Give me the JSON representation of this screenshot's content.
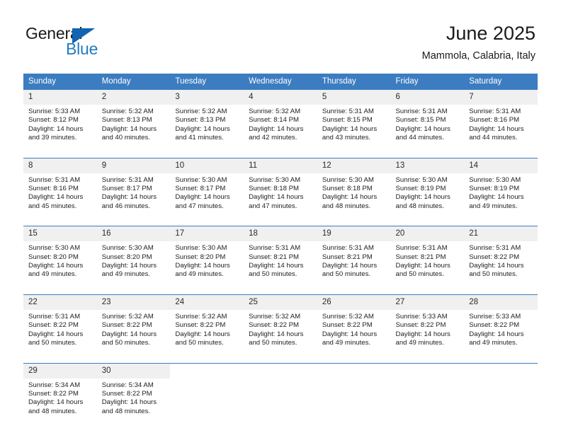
{
  "brand": {
    "name_part1": "General",
    "name_part2": "Blue",
    "accent_color": "#1e7bc4",
    "flag_color": "#1263b0"
  },
  "header": {
    "title": "June 2025",
    "subtitle": "Mammola, Calabria, Italy",
    "header_bg_color": "#3b7dc0"
  },
  "weekdays": [
    "Sunday",
    "Monday",
    "Tuesday",
    "Wednesday",
    "Thursday",
    "Friday",
    "Saturday"
  ],
  "weeks": [
    [
      {
        "day": "1",
        "sunrise": "Sunrise: 5:33 AM",
        "sunset": "Sunset: 8:12 PM",
        "daylight_line1": "Daylight: 14 hours",
        "daylight_line2": "and 39 minutes."
      },
      {
        "day": "2",
        "sunrise": "Sunrise: 5:32 AM",
        "sunset": "Sunset: 8:13 PM",
        "daylight_line1": "Daylight: 14 hours",
        "daylight_line2": "and 40 minutes."
      },
      {
        "day": "3",
        "sunrise": "Sunrise: 5:32 AM",
        "sunset": "Sunset: 8:13 PM",
        "daylight_line1": "Daylight: 14 hours",
        "daylight_line2": "and 41 minutes."
      },
      {
        "day": "4",
        "sunrise": "Sunrise: 5:32 AM",
        "sunset": "Sunset: 8:14 PM",
        "daylight_line1": "Daylight: 14 hours",
        "daylight_line2": "and 42 minutes."
      },
      {
        "day": "5",
        "sunrise": "Sunrise: 5:31 AM",
        "sunset": "Sunset: 8:15 PM",
        "daylight_line1": "Daylight: 14 hours",
        "daylight_line2": "and 43 minutes."
      },
      {
        "day": "6",
        "sunrise": "Sunrise: 5:31 AM",
        "sunset": "Sunset: 8:15 PM",
        "daylight_line1": "Daylight: 14 hours",
        "daylight_line2": "and 44 minutes."
      },
      {
        "day": "7",
        "sunrise": "Sunrise: 5:31 AM",
        "sunset": "Sunset: 8:16 PM",
        "daylight_line1": "Daylight: 14 hours",
        "daylight_line2": "and 44 minutes."
      }
    ],
    [
      {
        "day": "8",
        "sunrise": "Sunrise: 5:31 AM",
        "sunset": "Sunset: 8:16 PM",
        "daylight_line1": "Daylight: 14 hours",
        "daylight_line2": "and 45 minutes."
      },
      {
        "day": "9",
        "sunrise": "Sunrise: 5:31 AM",
        "sunset": "Sunset: 8:17 PM",
        "daylight_line1": "Daylight: 14 hours",
        "daylight_line2": "and 46 minutes."
      },
      {
        "day": "10",
        "sunrise": "Sunrise: 5:30 AM",
        "sunset": "Sunset: 8:17 PM",
        "daylight_line1": "Daylight: 14 hours",
        "daylight_line2": "and 47 minutes."
      },
      {
        "day": "11",
        "sunrise": "Sunrise: 5:30 AM",
        "sunset": "Sunset: 8:18 PM",
        "daylight_line1": "Daylight: 14 hours",
        "daylight_line2": "and 47 minutes."
      },
      {
        "day": "12",
        "sunrise": "Sunrise: 5:30 AM",
        "sunset": "Sunset: 8:18 PM",
        "daylight_line1": "Daylight: 14 hours",
        "daylight_line2": "and 48 minutes."
      },
      {
        "day": "13",
        "sunrise": "Sunrise: 5:30 AM",
        "sunset": "Sunset: 8:19 PM",
        "daylight_line1": "Daylight: 14 hours",
        "daylight_line2": "and 48 minutes."
      },
      {
        "day": "14",
        "sunrise": "Sunrise: 5:30 AM",
        "sunset": "Sunset: 8:19 PM",
        "daylight_line1": "Daylight: 14 hours",
        "daylight_line2": "and 49 minutes."
      }
    ],
    [
      {
        "day": "15",
        "sunrise": "Sunrise: 5:30 AM",
        "sunset": "Sunset: 8:20 PM",
        "daylight_line1": "Daylight: 14 hours",
        "daylight_line2": "and 49 minutes."
      },
      {
        "day": "16",
        "sunrise": "Sunrise: 5:30 AM",
        "sunset": "Sunset: 8:20 PM",
        "daylight_line1": "Daylight: 14 hours",
        "daylight_line2": "and 49 minutes."
      },
      {
        "day": "17",
        "sunrise": "Sunrise: 5:30 AM",
        "sunset": "Sunset: 8:20 PM",
        "daylight_line1": "Daylight: 14 hours",
        "daylight_line2": "and 49 minutes."
      },
      {
        "day": "18",
        "sunrise": "Sunrise: 5:31 AM",
        "sunset": "Sunset: 8:21 PM",
        "daylight_line1": "Daylight: 14 hours",
        "daylight_line2": "and 50 minutes."
      },
      {
        "day": "19",
        "sunrise": "Sunrise: 5:31 AM",
        "sunset": "Sunset: 8:21 PM",
        "daylight_line1": "Daylight: 14 hours",
        "daylight_line2": "and 50 minutes."
      },
      {
        "day": "20",
        "sunrise": "Sunrise: 5:31 AM",
        "sunset": "Sunset: 8:21 PM",
        "daylight_line1": "Daylight: 14 hours",
        "daylight_line2": "and 50 minutes."
      },
      {
        "day": "21",
        "sunrise": "Sunrise: 5:31 AM",
        "sunset": "Sunset: 8:22 PM",
        "daylight_line1": "Daylight: 14 hours",
        "daylight_line2": "and 50 minutes."
      }
    ],
    [
      {
        "day": "22",
        "sunrise": "Sunrise: 5:31 AM",
        "sunset": "Sunset: 8:22 PM",
        "daylight_line1": "Daylight: 14 hours",
        "daylight_line2": "and 50 minutes."
      },
      {
        "day": "23",
        "sunrise": "Sunrise: 5:32 AM",
        "sunset": "Sunset: 8:22 PM",
        "daylight_line1": "Daylight: 14 hours",
        "daylight_line2": "and 50 minutes."
      },
      {
        "day": "24",
        "sunrise": "Sunrise: 5:32 AM",
        "sunset": "Sunset: 8:22 PM",
        "daylight_line1": "Daylight: 14 hours",
        "daylight_line2": "and 50 minutes."
      },
      {
        "day": "25",
        "sunrise": "Sunrise: 5:32 AM",
        "sunset": "Sunset: 8:22 PM",
        "daylight_line1": "Daylight: 14 hours",
        "daylight_line2": "and 50 minutes."
      },
      {
        "day": "26",
        "sunrise": "Sunrise: 5:32 AM",
        "sunset": "Sunset: 8:22 PM",
        "daylight_line1": "Daylight: 14 hours",
        "daylight_line2": "and 49 minutes."
      },
      {
        "day": "27",
        "sunrise": "Sunrise: 5:33 AM",
        "sunset": "Sunset: 8:22 PM",
        "daylight_line1": "Daylight: 14 hours",
        "daylight_line2": "and 49 minutes."
      },
      {
        "day": "28",
        "sunrise": "Sunrise: 5:33 AM",
        "sunset": "Sunset: 8:22 PM",
        "daylight_line1": "Daylight: 14 hours",
        "daylight_line2": "and 49 minutes."
      }
    ],
    [
      {
        "day": "29",
        "sunrise": "Sunrise: 5:34 AM",
        "sunset": "Sunset: 8:22 PM",
        "daylight_line1": "Daylight: 14 hours",
        "daylight_line2": "and 48 minutes."
      },
      {
        "day": "30",
        "sunrise": "Sunrise: 5:34 AM",
        "sunset": "Sunset: 8:22 PM",
        "daylight_line1": "Daylight: 14 hours",
        "daylight_line2": "and 48 minutes."
      },
      {
        "day": "",
        "sunrise": "",
        "sunset": "",
        "daylight_line1": "",
        "daylight_line2": ""
      },
      {
        "day": "",
        "sunrise": "",
        "sunset": "",
        "daylight_line1": "",
        "daylight_line2": ""
      },
      {
        "day": "",
        "sunrise": "",
        "sunset": "",
        "daylight_line1": "",
        "daylight_line2": ""
      },
      {
        "day": "",
        "sunrise": "",
        "sunset": "",
        "daylight_line1": "",
        "daylight_line2": ""
      },
      {
        "day": "",
        "sunrise": "",
        "sunset": "",
        "daylight_line1": "",
        "daylight_line2": ""
      }
    ]
  ]
}
